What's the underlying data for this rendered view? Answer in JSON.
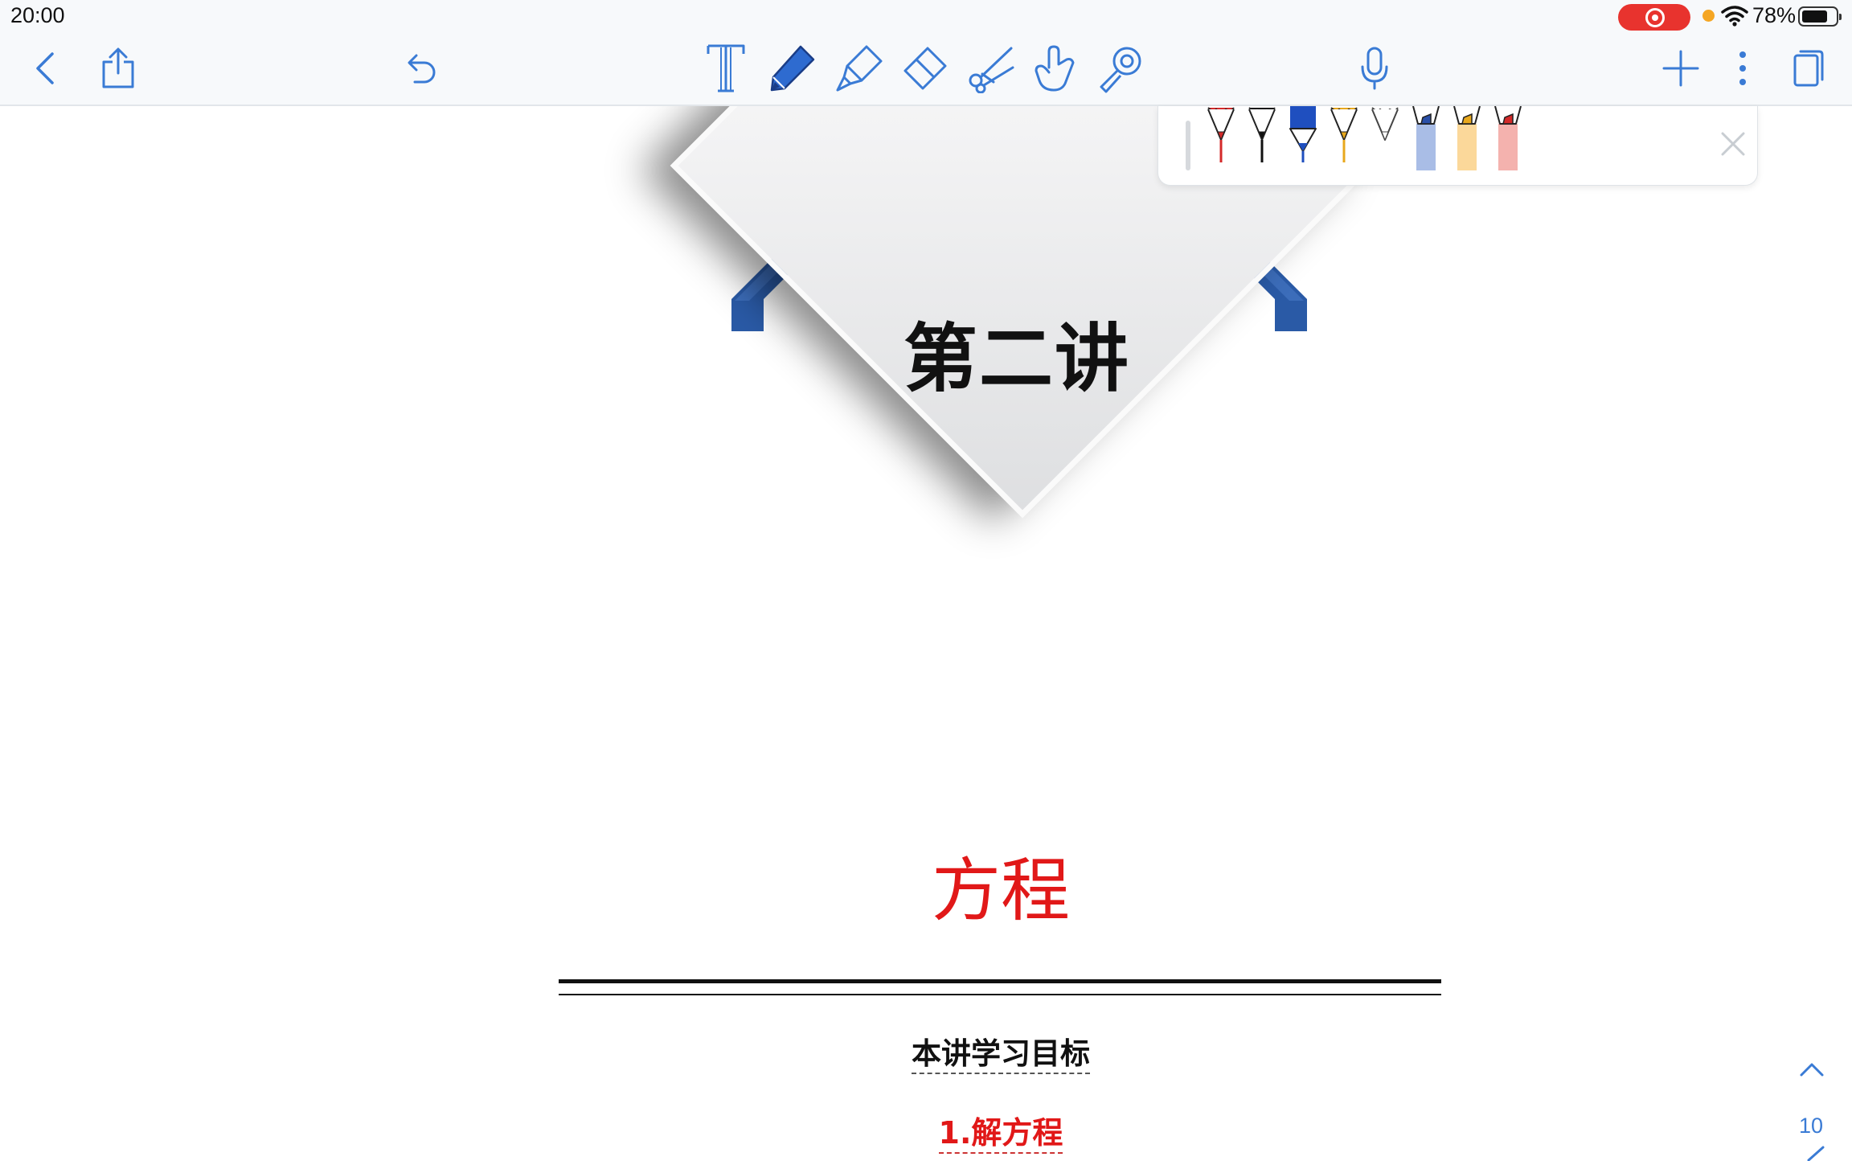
{
  "status_bar": {
    "time": "20:00",
    "battery_percent_label": "78%",
    "battery_level": 0.78,
    "recording_color": "#e8332e"
  },
  "toolbar": {
    "left": [
      "back-icon",
      "share-icon",
      "undo-icon"
    ],
    "tools": [
      "text-tool-icon",
      "pen-tool-icon",
      "highlighter-tool-icon",
      "eraser-tool-icon",
      "lasso-scissors-icon",
      "hand-pointer-icon",
      "laser-pointer-icon"
    ],
    "active_tool": "pen-tool-icon",
    "center_right": [
      "microphone-icon"
    ],
    "right": [
      "add-icon",
      "more-icon",
      "pages-icon"
    ],
    "accent_color": "#3a7bd5"
  },
  "pen_palette": {
    "pens": [
      {
        "kind": "pen",
        "color": "#d42a2a"
      },
      {
        "kind": "pen",
        "color": "#111111"
      },
      {
        "kind": "pen",
        "color": "#1f4fbf",
        "selected": true
      },
      {
        "kind": "pen",
        "color": "#e8a81d"
      },
      {
        "kind": "pen",
        "color": "#ffffff"
      },
      {
        "kind": "highlighter",
        "color": "#a9bde6"
      },
      {
        "kind": "highlighter",
        "color": "#fbd89a"
      },
      {
        "kind": "highlighter",
        "color": "#f4b2ae"
      }
    ],
    "close_icon": "close-icon"
  },
  "document": {
    "lecture_title": "第二讲",
    "topic_title": "方程",
    "goals_heading": "本讲学习目标",
    "goal_1": "1.解方程",
    "banner_color": "#2a5aa6",
    "topic_color": "#e11818"
  },
  "page_nav": {
    "page_number": "10"
  }
}
